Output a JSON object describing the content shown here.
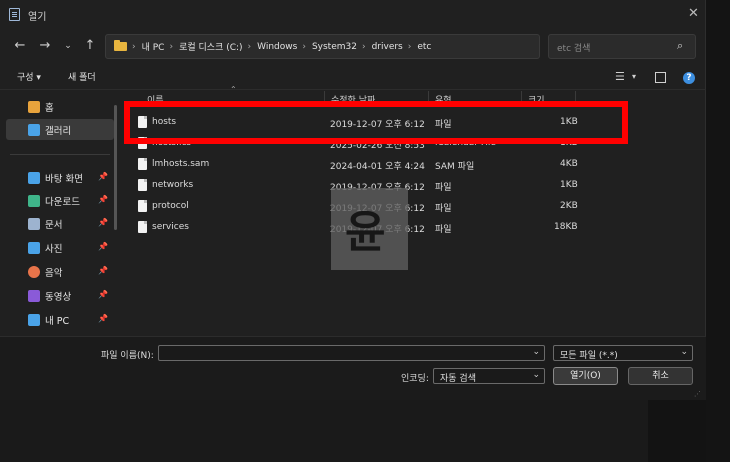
{
  "window": {
    "title": "열기"
  },
  "address": {
    "crumbs": [
      "내 PC",
      "로컬 디스크 (C:)",
      "Windows",
      "System32",
      "drivers",
      "etc"
    ]
  },
  "search": {
    "placeholder": "etc 검색"
  },
  "toolbar": {
    "organize": "구성 ▾",
    "new_folder": "새 폴더"
  },
  "sidebar": {
    "items": [
      {
        "label": "홈",
        "icon": "home-icon",
        "color": "#e8a33c",
        "pinned": false,
        "selected": false
      },
      {
        "label": "갤러리",
        "icon": "gallery-icon",
        "color": "#4aa3e8",
        "pinned": false,
        "selected": true
      },
      {
        "label": "바탕 화면",
        "icon": "desktop-icon",
        "color": "#4aa3e8",
        "pinned": true,
        "selected": false
      },
      {
        "label": "다운로드",
        "icon": "download-icon",
        "color": "#3fb58a",
        "pinned": true,
        "selected": false
      },
      {
        "label": "문서",
        "icon": "documents-icon",
        "color": "#9db3cf",
        "pinned": true,
        "selected": false
      },
      {
        "label": "사진",
        "icon": "pictures-icon",
        "color": "#4aa3e8",
        "pinned": true,
        "selected": false
      },
      {
        "label": "음악",
        "icon": "music-icon",
        "color": "#e8744a",
        "pinned": true,
        "selected": false
      },
      {
        "label": "동영상",
        "icon": "videos-icon",
        "color": "#8a5ad8",
        "pinned": true,
        "selected": false
      },
      {
        "label": "내 PC",
        "icon": "this-pc-icon",
        "color": "#4aa3e8",
        "pinned": true,
        "selected": false
      }
    ]
  },
  "columns": {
    "name": "이름",
    "date": "수정한 날짜",
    "type": "유형",
    "size": "크기"
  },
  "files": [
    {
      "name": "hosts",
      "date": "2019-12-07 오후 6:12",
      "type": "파일",
      "size": "1KB"
    },
    {
      "name": "hosts.ics",
      "date": "2025-02-26 오전 8:53",
      "type": "iCalendar File",
      "size": "1KB"
    },
    {
      "name": "lmhosts.sam",
      "date": "2024-04-01 오후 4:24",
      "type": "SAM 파일",
      "size": "4KB"
    },
    {
      "name": "networks",
      "date": "2019-12-07 오후 6:12",
      "type": "파일",
      "size": "1KB"
    },
    {
      "name": "protocol",
      "date": "2019-12-07 오후 6:12",
      "type": "파일",
      "size": "2KB"
    },
    {
      "name": "services",
      "date": "2019-12-07 오후 6:12",
      "type": "파일",
      "size": "18KB"
    }
  ],
  "watermark": {
    "text": "윤"
  },
  "bottom": {
    "filename_label": "파일 이름(N):",
    "filename_value": "",
    "filter_value": "모든 파일  (*.*)",
    "encoding_label": "인코딩:",
    "encoding_value": "자동 검색",
    "open_button": "열기(O)",
    "cancel_button": "취소"
  },
  "colors": {
    "highlight": "#ff0000",
    "accent": "#3d8fe0"
  }
}
